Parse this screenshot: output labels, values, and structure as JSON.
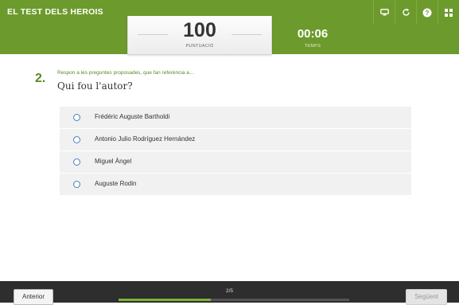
{
  "header": {
    "title": "EL TEST DELS HEROIS",
    "icons": [
      "cast-icon",
      "restart-icon",
      "help-icon",
      "grid-icon"
    ]
  },
  "score": {
    "value": "100",
    "label": "PUNTUACIÓ"
  },
  "timer": {
    "value": "00:06",
    "label": "TEMPS"
  },
  "question": {
    "number": "2.",
    "instruction": "Respon a les preguntes proposades, que fan referència a...",
    "text": "Qui fou l'autor?"
  },
  "answers": [
    {
      "label": "Frédéric Auguste Bartholdi"
    },
    {
      "label": "Antonio Julio Rodríguez Hernández"
    },
    {
      "label": "Miguel Àngel"
    },
    {
      "label": "Auguste Rodin"
    }
  ],
  "footer": {
    "prev_label": "Anterior",
    "next_label": "Següent",
    "page_indicator": "2/5",
    "progress": 0.4
  },
  "colors": {
    "header_green": "#6c9a2c",
    "accent_green": "#5a8a25",
    "radio_blue": "#4a7fc0",
    "footer_dark": "#2e2e2e"
  }
}
